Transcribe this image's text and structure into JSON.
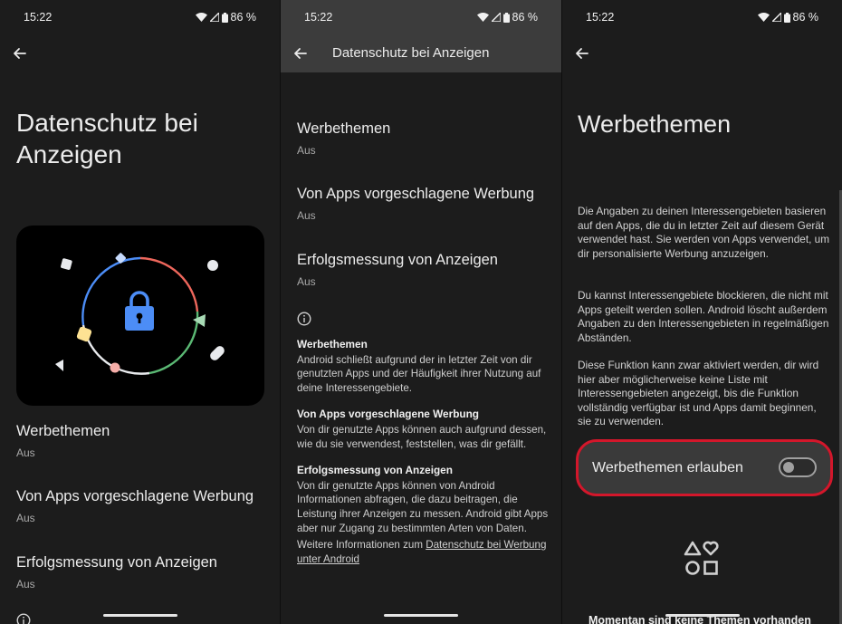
{
  "status_bar": {
    "time": "15:22",
    "battery": "86 %"
  },
  "screen1": {
    "title": "Datenschutz bei Anzeigen",
    "items": [
      {
        "title": "Werbethemen",
        "status": "Aus"
      },
      {
        "title": "Von Apps vorgeschlagene Werbung",
        "status": "Aus"
      },
      {
        "title": "Erfolgsmessung von Anzeigen",
        "status": "Aus"
      }
    ]
  },
  "screen2": {
    "toolbar_title": "Datenschutz bei Anzeigen",
    "items": [
      {
        "title": "Werbethemen",
        "status": "Aus"
      },
      {
        "title": "Von Apps vorgeschlagene Werbung",
        "status": "Aus"
      },
      {
        "title": "Erfolgsmessung von Anzeigen",
        "status": "Aus"
      }
    ],
    "info": [
      {
        "heading": "Werbethemen",
        "text": "Android schließt aufgrund der in letzter Zeit von dir genutzten Apps und der Häufigkeit ihrer Nutzung auf deine Interessengebiete."
      },
      {
        "heading": "Von Apps vorgeschlagene Werbung",
        "text": "Von dir genutzte Apps können auch aufgrund dessen, wie du sie verwendest, feststellen, was dir gefällt."
      },
      {
        "heading": "Erfolgsmessung von Anzeigen",
        "text": "Von dir genutzte Apps können von Android Informationen abfragen, die dazu beitragen, die Leistung ihrer Anzeigen zu messen. Android gibt Apps aber nur Zugang zu bestimmten Arten von Daten."
      }
    ],
    "more_info_prefix": "Weitere Informationen zum ",
    "more_info_link": "Datenschutz bei Werbung unter Android"
  },
  "screen3": {
    "title": "Werbethemen",
    "paragraphs": [
      "Die Angaben zu deinen Interessengebieten basieren auf den Apps, die du in letzter Zeit auf diesem Gerät verwendet hast. Sie werden von Apps verwendet, um dir personalisierte Werbung anzuzeigen.",
      "Du kannst Interessengebiete blockieren, die nicht mit Apps geteilt werden sollen. Android löscht außerdem Angaben zu den Interessengebieten in regelmäßigen Abständen.",
      "Diese Funktion kann zwar aktiviert werden, dir wird hier aber möglicherweise keine Liste mit Interessengebieten angezeigt, bis die Funktion vollständig verfügbar ist und Apps damit beginnen, sie zu verwenden."
    ],
    "toggle_label": "Werbethemen erlauben",
    "toggle_on": false,
    "highlight_color": "#d3172b",
    "empty_text": "Momentan sind keine Themen vorhanden"
  }
}
